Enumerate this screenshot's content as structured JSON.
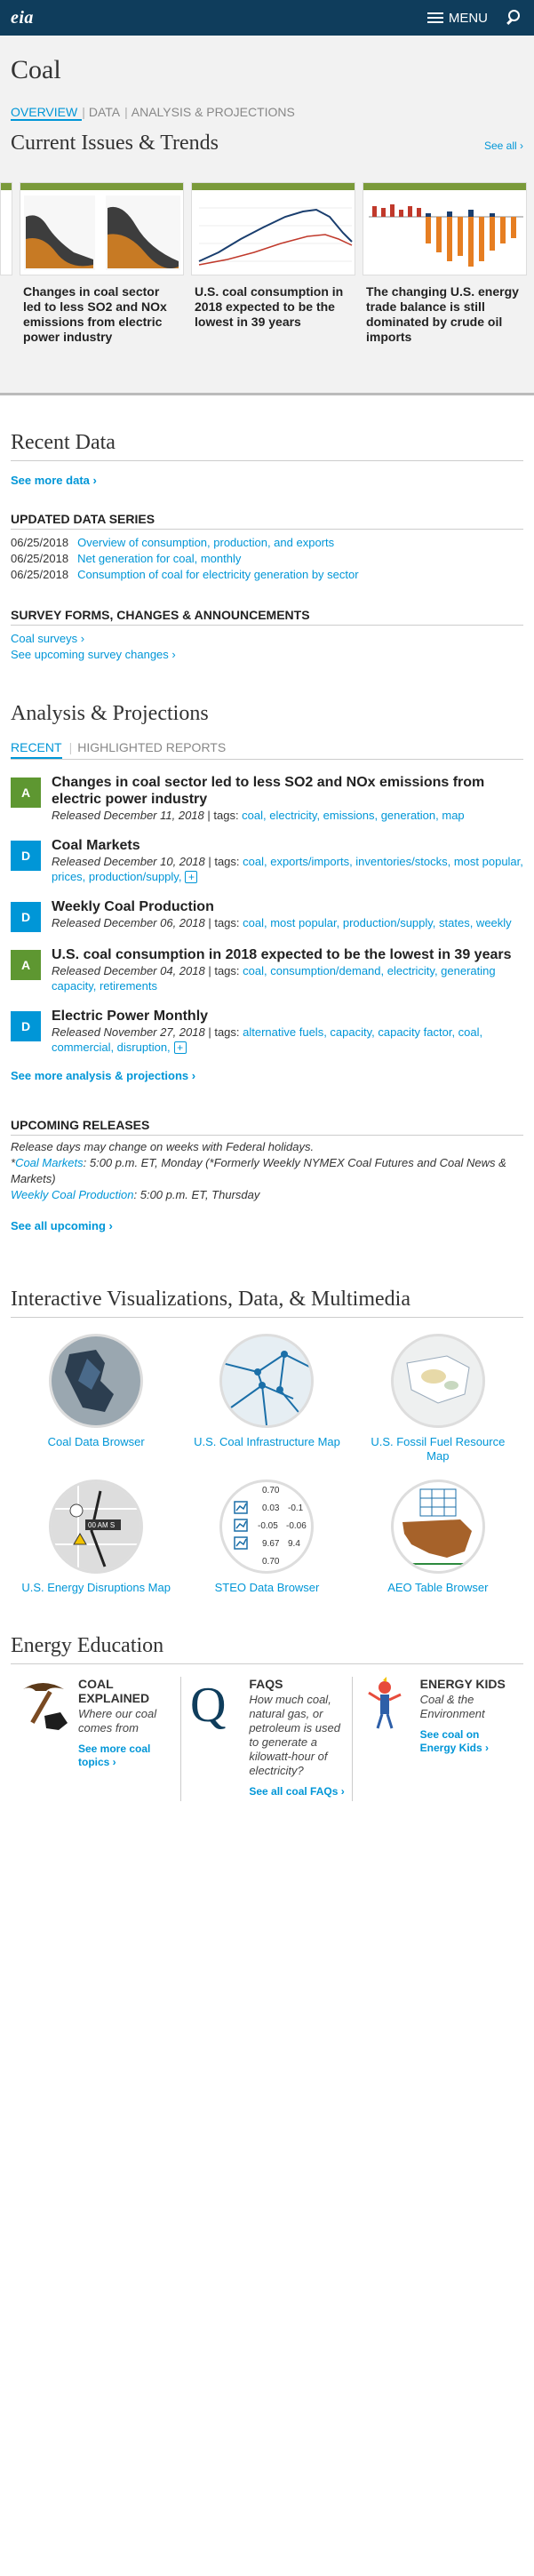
{
  "header": {
    "logo": "eia",
    "menu_label": "MENU"
  },
  "page": {
    "title": "Coal"
  },
  "subnav": [
    "OVERVIEW",
    "DATA",
    "ANALYSIS & PROJECTIONS"
  ],
  "current_issues": {
    "heading": "Current Issues & Trends",
    "see_all": "See all ›",
    "cards": [
      "Changes in coal sector led to less SO2 and NOx emissions from electric power industry",
      "U.S. coal consumption in 2018 expected to be the lowest in 39 years",
      "The changing U.S. energy trade balance is still dominated by crude oil imports"
    ]
  },
  "recent_data": {
    "heading": "Recent Data",
    "see_more": "See more data ›",
    "updated_heading": "UPDATED DATA SERIES",
    "rows": [
      {
        "date": "06/25/2018",
        "label": "Overview of consumption, production, and exports"
      },
      {
        "date": "06/25/2018",
        "label": "Net generation for coal, monthly"
      },
      {
        "date": "06/25/2018",
        "label": "Consumption of coal for electricity generation by sector"
      }
    ],
    "survey_heading": "SURVEY FORMS, CHANGES & ANNOUNCEMENTS",
    "survey_links": [
      "Coal surveys ›",
      "See upcoming survey changes ›"
    ]
  },
  "analysis": {
    "heading": "Analysis & Projections",
    "tabs": [
      "RECENT",
      "HIGHLIGHTED REPORTS"
    ],
    "reports": [
      {
        "badge": "A",
        "title": "Changes in coal sector led to less SO2 and NOx emissions from electric power industry",
        "released": "Released December 11, 2018",
        "tags": "coal, electricity, emissions, generation, map",
        "more": false
      },
      {
        "badge": "D",
        "title": "Coal Markets",
        "released": "Released December 10, 2018",
        "tags": "coal, exports/imports, inventories/stocks, most popular, prices, production/supply,",
        "more": true
      },
      {
        "badge": "D",
        "title": "Weekly Coal Production",
        "released": "Released December 06, 2018",
        "tags": "coal, most popular, production/supply, states, weekly",
        "more": false
      },
      {
        "badge": "A",
        "title": "U.S. coal consumption in 2018 expected to be the lowest in 39 years",
        "released": "Released December 04, 2018",
        "tags": "coal, consumption/demand, electricity, generating capacity, retirements",
        "more": false
      },
      {
        "badge": "D",
        "title": "Electric Power Monthly",
        "released": "Released November 27, 2018",
        "tags": "alternative fuels, capacity, capacity factor, coal, commercial, disruption,",
        "more": true
      }
    ],
    "tags_label": " | tags: ",
    "see_more": "See more analysis & projections ›"
  },
  "upcoming": {
    "heading": "UPCOMING RELEASES",
    "note": "Release days may change on weeks with Federal holidays.",
    "star": "*",
    "coal_markets_link": "Coal Markets",
    "coal_markets_text": ": 5:00 p.m. ET, Monday (*Formerly Weekly NYMEX Coal Futures and Coal News & Markets)",
    "weekly_link": "Weekly Coal Production",
    "weekly_text": ": 5:00 p.m. ET, Thursday",
    "see_all": "See all upcoming ›"
  },
  "viz": {
    "heading": "Interactive Visualizations, Data, & Multimedia",
    "items": [
      {
        "label": "Coal Data Browser",
        "icon": "map-icon"
      },
      {
        "label": "U.S. Coal Infrastructure Map",
        "icon": "infrastructure-map-icon"
      },
      {
        "label": "U.S. Fossil Fuel Resource Map",
        "icon": "resource-map-icon"
      },
      {
        "label": "U.S. Energy Disruptions Map",
        "icon": "disruptions-map-icon"
      },
      {
        "label": "STEO Data Browser",
        "icon": "data-table-icon"
      },
      {
        "label": "AEO Table Browser",
        "icon": "us-map-table-icon"
      }
    ],
    "disruption_time": "00 AM S",
    "steo_values": [
      "0.70",
      "0.03",
      "-0.1",
      "-0.05",
      "-0.06",
      "9.67",
      "9.4",
      "0.70"
    ]
  },
  "education": {
    "heading": "Energy Education",
    "items": [
      {
        "title": "COAL EXPLAINED",
        "desc": "Where our coal comes from",
        "link": "See more coal topics ›",
        "icon": "pickaxe-icon"
      },
      {
        "title": "FAQS",
        "desc": "How much coal, natural gas, or petroleum is used to generate a kilowatt-hour of electricity?",
        "link": "See all coal FAQs ›",
        "icon": "q-icon"
      },
      {
        "title": "ENERGY KIDS",
        "desc": "Coal & the Environment",
        "link": "See coal on Energy Kids ›",
        "icon": "energy-kids-mascot-icon"
      }
    ]
  },
  "colors": {
    "navy": "#0f3d5c",
    "link_blue": "#0096d7",
    "analysis_green": "#5e9731",
    "data_blue": "#0096d7"
  }
}
